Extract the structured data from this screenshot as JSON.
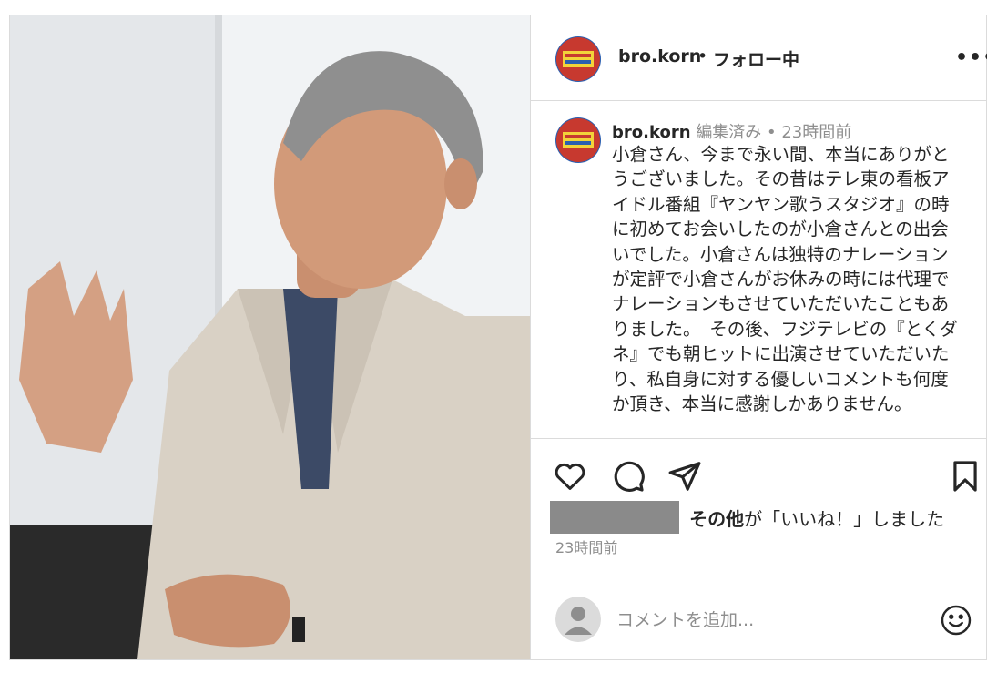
{
  "post": {
    "username": "bro.korn",
    "separator": "•",
    "follow_status": "フォロー中",
    "more_icon": "more-horizontal-icon"
  },
  "caption": {
    "username": "bro.korn",
    "edited": "編集済み",
    "separator": "•",
    "time": "23時間前",
    "text": "小倉さん、今まで永い間、本当にありがとうございました。その昔はテレ東の看板アイドル番組『ヤンヤン歌うスタジオ』の時に初めてお会いしたのが小倉さんとの出会いでした。小倉さんは独特のナレーションが定評で小倉さんがお休みの時には代理でナレーションもさせていただいたこともありました。　その後、フジテレビの『とくダネ』でも朝ヒットに出演させていただいたり、私自身に対する優しいコメントも何度か頂き、本当に感謝しかありません。"
  },
  "actions": {
    "icons": [
      "heart-icon",
      "comment-icon",
      "share-icon",
      "bookmark-icon"
    ]
  },
  "likes": {
    "others": "その他",
    "suffix": "が「いいね！」しました"
  },
  "timestamp": "23時間前",
  "comment": {
    "placeholder": "コメントを追加...",
    "emoji_icon": "emoji-smile-icon"
  },
  "colors": {
    "text": "#262626",
    "secondary": "#8e8e8e",
    "border": "#dbdbdb"
  }
}
